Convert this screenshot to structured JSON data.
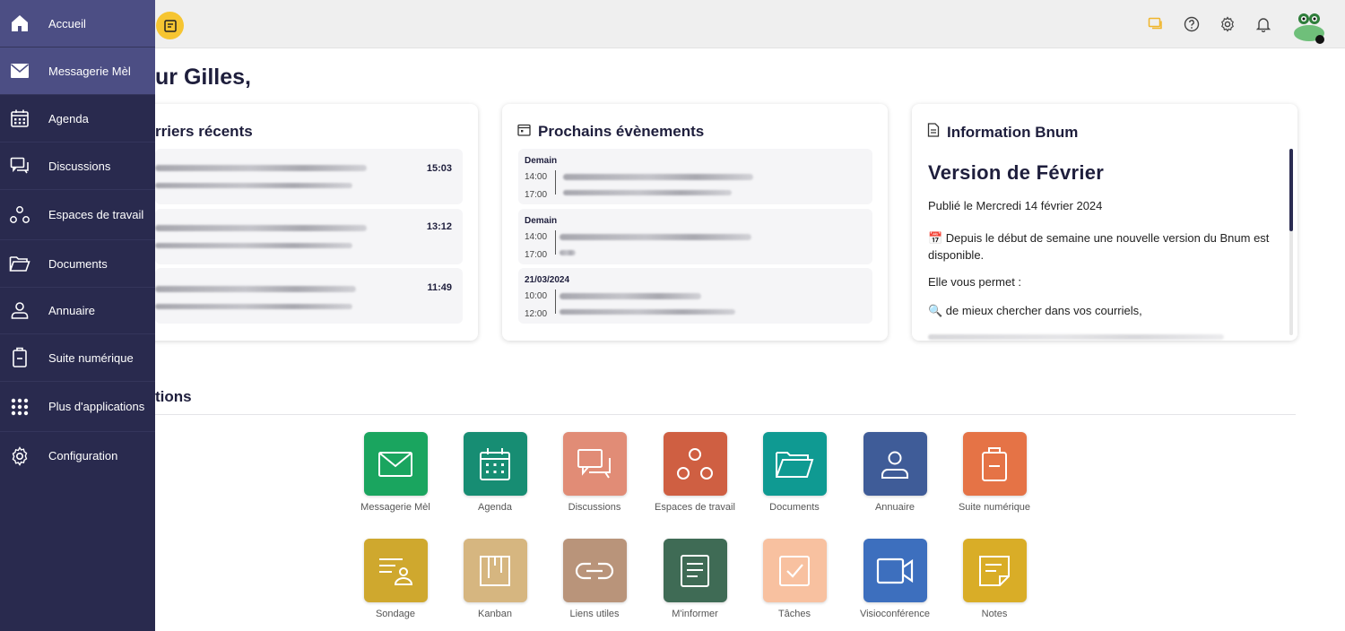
{
  "greeting": "ur Gilles,",
  "sidebar": {
    "items": [
      {
        "label": "Accueil",
        "icon": "home-icon"
      },
      {
        "label": "Messagerie Mèl",
        "icon": "mail-icon"
      },
      {
        "label": "Agenda",
        "icon": "calendar-icon"
      },
      {
        "label": "Discussions",
        "icon": "chat-icon"
      },
      {
        "label": "Espaces de travail",
        "icon": "workspaces-icon"
      },
      {
        "label": "Documents",
        "icon": "folder-icon"
      },
      {
        "label": "Annuaire",
        "icon": "user-icon"
      },
      {
        "label": "Suite numérique",
        "icon": "suite-icon"
      },
      {
        "label": "Plus d'applications",
        "icon": "grid-icon"
      },
      {
        "label": "Configuration",
        "icon": "gear-icon"
      }
    ]
  },
  "cards": {
    "mail": {
      "title": "rriers récents",
      "rows": [
        {
          "time": "15:03"
        },
        {
          "time": "13:12"
        },
        {
          "time": "11:49"
        }
      ]
    },
    "events": {
      "title": "Prochains évènements",
      "blocks": [
        {
          "day": "Demain",
          "start": "14:00",
          "end": "17:00"
        },
        {
          "day": "Demain",
          "start": "14:00",
          "end": "17:00"
        },
        {
          "day": "21/03/2024",
          "start": "10:00",
          "end": "12:00"
        }
      ]
    },
    "info": {
      "title": "Information Bnum",
      "heading": "Version de Février",
      "published": "Publié le Mercredi 14 février 2024",
      "p1": "📅 Depuis le début de semaine une nouvelle version du Bnum est disponible.",
      "p2": "Elle vous permet :",
      "p3": "🔍 de mieux chercher dans vos courriels,"
    }
  },
  "apps": {
    "title": "tions",
    "items": [
      {
        "label": "Messagerie Mèl",
        "color": "#1aa55f",
        "icon": "mail-icon"
      },
      {
        "label": "Agenda",
        "color": "#178d73",
        "icon": "calendar-icon"
      },
      {
        "label": "Discussions",
        "color": "#e18c76",
        "icon": "chat-icon"
      },
      {
        "label": "Espaces de travail",
        "color": "#cf5f42",
        "icon": "workspaces-icon"
      },
      {
        "label": "Documents",
        "color": "#0f9a92",
        "icon": "folder-icon"
      },
      {
        "label": "Annuaire",
        "color": "#3f5c98",
        "icon": "user-icon"
      },
      {
        "label": "Suite numérique",
        "color": "#e57346",
        "icon": "suite-icon"
      },
      {
        "label": "Sondage",
        "color": "#cfa82e",
        "icon": "poll-icon"
      },
      {
        "label": "Kanban",
        "color": "#d6b680",
        "icon": "kanban-icon"
      },
      {
        "label": "Liens utiles",
        "color": "#b9947a",
        "icon": "link-icon"
      },
      {
        "label": "M'informer",
        "color": "#3f6b55",
        "icon": "news-icon"
      },
      {
        "label": "Tâches",
        "color": "#f8c1a0",
        "icon": "task-icon"
      },
      {
        "label": "Visioconférence",
        "color": "#3d6fbe",
        "icon": "video-icon"
      },
      {
        "label": "Notes",
        "color": "#d9ad27",
        "icon": "note-icon"
      }
    ]
  },
  "colors": {
    "sidebar_bg": "#292a4e",
    "sidebar_active": "#4c4e84",
    "accent_yellow": "#f6c531"
  }
}
